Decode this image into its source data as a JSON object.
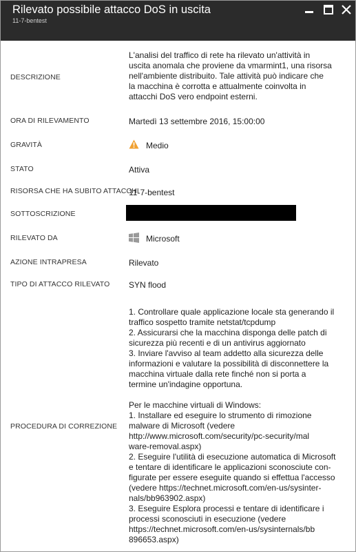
{
  "window": {
    "title": "Rilevato possibile attacco DoS in uscita",
    "subtitle": "11-7-bentest"
  },
  "fields": {
    "descrizione": {
      "label": "DESCRIZIONE",
      "lines": [
        "L'analisi del traffico di rete ha rilevato un'attività in",
        "uscita anomala che proviene da vmarmint1, una risorsa",
        "nell'ambiente distribuito.  Tale attività può indicare che",
        "la macchina è corrotta e attualmente coinvolta in",
        "attacchi DoS vero endpoint esterni."
      ]
    },
    "ora": {
      "label": "ORA DI RILEVAMENTO",
      "value": "Martedì 13 settembre 2016, 15:00:00"
    },
    "gravita": {
      "label": "GRAVITÀ",
      "value": "Medio",
      "icon": "warning-icon",
      "icon_color": "#f0a030"
    },
    "stato": {
      "label": "STATO",
      "value": "Attiva"
    },
    "risorsa": {
      "label": "RISORSA CHE HA SUBITO ATTACCHI",
      "value": "11-7-bentest"
    },
    "sottoscrizione": {
      "label": "SOTTOSCRIZIONE"
    },
    "rilevato_da": {
      "label": "RILEVATO DA",
      "value": "Microsoft",
      "icon": "windows-logo-icon"
    },
    "azione": {
      "label": "AZIONE INTRAPRESA",
      "value": "Rilevato"
    },
    "tipo": {
      "label": "TIPO DI ATTACCO RILEVATO",
      "value": "SYN flood"
    },
    "procedura": {
      "label": "PROCEDURA DI CORREZIONE",
      "block1": [
        "1. Controllare quale applicazione locale sta generando il",
        "traffico sospetto tramite netstat/tcpdump",
        "2. Assicurarsi che la macchina disponga delle patch di",
        "sicurezza più recenti e di un antivirus aggiornato",
        "3. Inviare l'avviso al team addetto alla sicurezza delle",
        "informazioni e valutare la possibilità di disconnettere la",
        "macchina virtuale dalla rete finché non si porta a",
        "termine un'indagine opportuna."
      ],
      "block2": [
        "Per le macchine virtuali di Windows:",
        "1. Installare ed eseguire lo strumento di rimozione",
        "malware di Microsoft (vedere",
        "http://www.microsoft.com/security/pc-security/mal",
        "ware-removal.aspx)",
        "2. Eseguire l'utilità di esecuzione automatica di Microsoft",
        "e tentare di identificare le applicazioni sconosciute con-",
        "figurate per essere eseguite quando si effettua l'accesso",
        "(vedere https://technet.microsoft.com/en-us/sysinter-",
        "nals/bb963902.aspx)",
        "3. Eseguire Esplora processi e tentare di identificare i",
        "processi sconosciuti in esecuzione (vedere",
        "https://technet.microsoft.com/en-us/sysinternals/bb",
        "896653.aspx)"
      ]
    }
  }
}
